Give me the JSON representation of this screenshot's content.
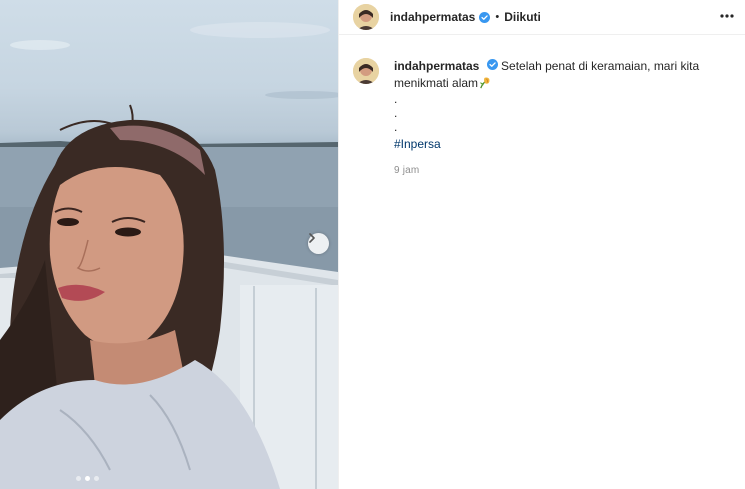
{
  "post": {
    "username": "indahpermatas",
    "follow_status": "Diikuti",
    "separator": "•",
    "caption": {
      "text": "Setelah penat di keramaian, mari kita menikmati alam",
      "emoji": "wilted-flower-emoji",
      "dots": [
        ".",
        ".",
        "."
      ],
      "hashtag": "#Inpersa",
      "time": "9 jam"
    },
    "carousel": {
      "total_slides": 3,
      "active_slide": 2
    }
  },
  "icons": {
    "verified": "verified-badge-icon",
    "more": "more-options-icon",
    "next": "chevron-right-icon"
  },
  "colors": {
    "verified_blue": "#3897f0",
    "hashtag_blue": "#00376b",
    "muted": "#8e8e8e",
    "text": "#262626"
  }
}
